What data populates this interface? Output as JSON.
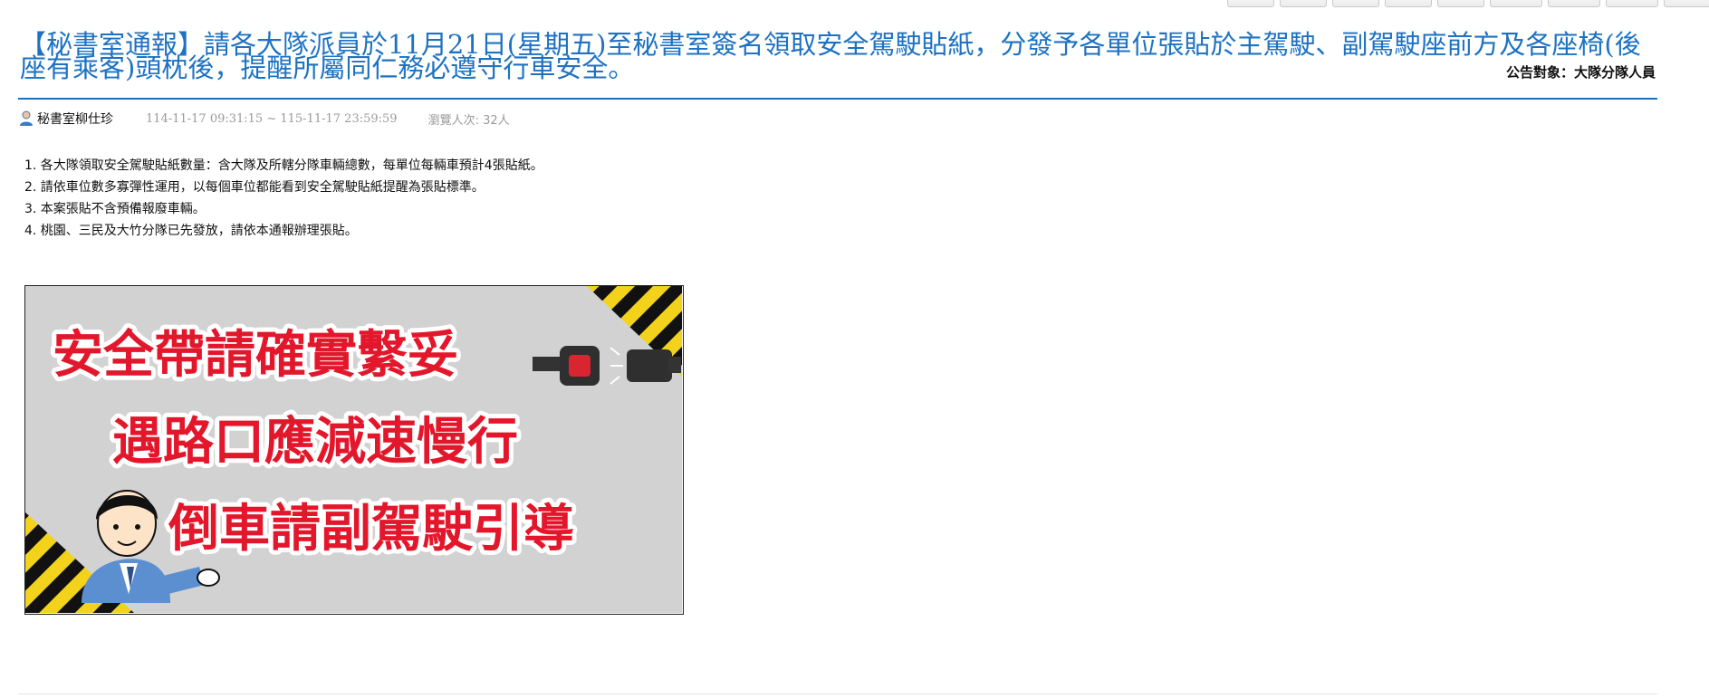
{
  "announcement": {
    "title": "【秘書室通報】請各大隊派員於11月21日(星期五)至秘書室簽名領取安全駕駛貼紙，分發予各單位張貼於主駕駛、副駕駛座前方及各座椅(後座有乘客)頭枕後，提醒所屬同仁務必遵守行車安全。",
    "audience": "公告對象：大隊分隊人員",
    "author": "秘書室柳仕珍",
    "dates": "114-11-17 09:31:15 ~ 115-11-17 23:59:59",
    "views": "瀏覽人次: 32人",
    "items": [
      "1. 各大隊領取安全駕駛貼紙數量：含大隊及所轄分隊車輛總數，每單位每輛車預計4張貼紙。",
      "2. 請依車位數多寡彈性運用，以每個車位都能看到安全駕駛貼紙提醒為張貼標準。",
      "3. 本案張貼不含預備報廢車輛。",
      "4. 桃園、三民及大竹分隊已先發放，請依本通報辦理張貼。"
    ]
  },
  "banner": {
    "line1": "安全帶請確實繫妥",
    "line2": "遇路口應減速慢行",
    "line3": "倒車請副駕駛引導",
    "bg_color": "#d2d2d2",
    "text_color": "#e3172b",
    "icons": [
      "seatbelt-buckle-icon",
      "officer-mascot-icon",
      "hazard-stripes-icon"
    ]
  },
  "colors": {
    "accent": "#1e6fbf",
    "title": "#1d72c2",
    "meta": "#9a9a9a"
  }
}
